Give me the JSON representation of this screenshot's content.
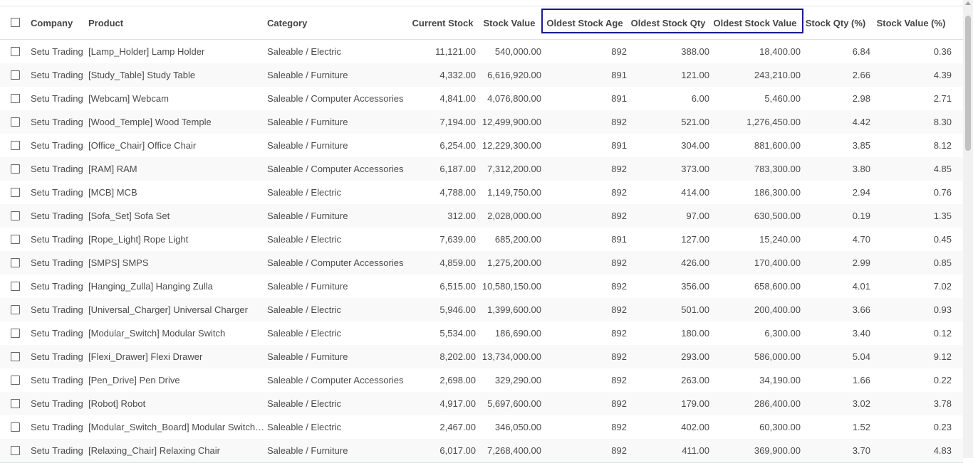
{
  "table": {
    "columns": {
      "company": "Company",
      "product": "Product",
      "category": "Category",
      "current_stock": "Current Stock",
      "stock_value": "Stock Value",
      "oldest_stock_age": "Oldest Stock Age",
      "oldest_stock_qty": "Oldest Stock Qty",
      "oldest_stock_value": "Oldest Stock Value",
      "stock_qty_pct": "Stock Qty (%)",
      "stock_value_pct": "Stock Value (%)"
    },
    "rows": [
      {
        "company": "Setu Trading",
        "product": "[Lamp_Holder] Lamp Holder",
        "category": "Saleable / Electric",
        "current_stock": "11,121.00",
        "stock_value": "540,000.00",
        "oldest_stock_age": "892",
        "oldest_stock_qty": "388.00",
        "oldest_stock_value": "18,400.00",
        "stock_qty_pct": "6.84",
        "stock_value_pct": "0.36"
      },
      {
        "company": "Setu Trading",
        "product": "[Study_Table] Study Table",
        "category": "Saleable / Furniture",
        "current_stock": "4,332.00",
        "stock_value": "6,616,920.00",
        "oldest_stock_age": "891",
        "oldest_stock_qty": "121.00",
        "oldest_stock_value": "243,210.00",
        "stock_qty_pct": "2.66",
        "stock_value_pct": "4.39"
      },
      {
        "company": "Setu Trading",
        "product": "[Webcam] Webcam",
        "category": "Saleable / Computer Accessories",
        "current_stock": "4,841.00",
        "stock_value": "4,076,800.00",
        "oldest_stock_age": "891",
        "oldest_stock_qty": "6.00",
        "oldest_stock_value": "5,460.00",
        "stock_qty_pct": "2.98",
        "stock_value_pct": "2.71"
      },
      {
        "company": "Setu Trading",
        "product": "[Wood_Temple] Wood Temple",
        "category": "Saleable / Furniture",
        "current_stock": "7,194.00",
        "stock_value": "12,499,900.00",
        "oldest_stock_age": "892",
        "oldest_stock_qty": "521.00",
        "oldest_stock_value": "1,276,450.00",
        "stock_qty_pct": "4.42",
        "stock_value_pct": "8.30"
      },
      {
        "company": "Setu Trading",
        "product": "[Office_Chair] Office Chair",
        "category": "Saleable / Furniture",
        "current_stock": "6,254.00",
        "stock_value": "12,229,300.00",
        "oldest_stock_age": "891",
        "oldest_stock_qty": "304.00",
        "oldest_stock_value": "881,600.00",
        "stock_qty_pct": "3.85",
        "stock_value_pct": "8.12"
      },
      {
        "company": "Setu Trading",
        "product": "[RAM] RAM",
        "category": "Saleable / Computer Accessories",
        "current_stock": "6,187.00",
        "stock_value": "7,312,200.00",
        "oldest_stock_age": "892",
        "oldest_stock_qty": "373.00",
        "oldest_stock_value": "783,300.00",
        "stock_qty_pct": "3.80",
        "stock_value_pct": "4.85"
      },
      {
        "company": "Setu Trading",
        "product": "[MCB] MCB",
        "category": "Saleable / Electric",
        "current_stock": "4,788.00",
        "stock_value": "1,149,750.00",
        "oldest_stock_age": "892",
        "oldest_stock_qty": "414.00",
        "oldest_stock_value": "186,300.00",
        "stock_qty_pct": "2.94",
        "stock_value_pct": "0.76"
      },
      {
        "company": "Setu Trading",
        "product": "[Sofa_Set] Sofa Set",
        "category": "Saleable / Furniture",
        "current_stock": "312.00",
        "stock_value": "2,028,000.00",
        "oldest_stock_age": "892",
        "oldest_stock_qty": "97.00",
        "oldest_stock_value": "630,500.00",
        "stock_qty_pct": "0.19",
        "stock_value_pct": "1.35"
      },
      {
        "company": "Setu Trading",
        "product": "[Rope_Light] Rope Light",
        "category": "Saleable / Electric",
        "current_stock": "7,639.00",
        "stock_value": "685,200.00",
        "oldest_stock_age": "891",
        "oldest_stock_qty": "127.00",
        "oldest_stock_value": "15,240.00",
        "stock_qty_pct": "4.70",
        "stock_value_pct": "0.45"
      },
      {
        "company": "Setu Trading",
        "product": "[SMPS] SMPS",
        "category": "Saleable / Computer Accessories",
        "current_stock": "4,859.00",
        "stock_value": "1,275,200.00",
        "oldest_stock_age": "892",
        "oldest_stock_qty": "426.00",
        "oldest_stock_value": "170,400.00",
        "stock_qty_pct": "2.99",
        "stock_value_pct": "0.85"
      },
      {
        "company": "Setu Trading",
        "product": "[Hanging_Zulla] Hanging Zulla",
        "category": "Saleable / Furniture",
        "current_stock": "6,515.00",
        "stock_value": "10,580,150.00",
        "oldest_stock_age": "892",
        "oldest_stock_qty": "356.00",
        "oldest_stock_value": "658,600.00",
        "stock_qty_pct": "4.01",
        "stock_value_pct": "7.02"
      },
      {
        "company": "Setu Trading",
        "product": "[Universal_Charger] Universal Charger",
        "category": "Saleable / Electric",
        "current_stock": "5,946.00",
        "stock_value": "1,399,600.00",
        "oldest_stock_age": "892",
        "oldest_stock_qty": "501.00",
        "oldest_stock_value": "200,400.00",
        "stock_qty_pct": "3.66",
        "stock_value_pct": "0.93"
      },
      {
        "company": "Setu Trading",
        "product": "[Modular_Switch] Modular Switch",
        "category": "Saleable / Electric",
        "current_stock": "5,534.00",
        "stock_value": "186,690.00",
        "oldest_stock_age": "892",
        "oldest_stock_qty": "180.00",
        "oldest_stock_value": "6,300.00",
        "stock_qty_pct": "3.40",
        "stock_value_pct": "0.12"
      },
      {
        "company": "Setu Trading",
        "product": "[Flexi_Drawer] Flexi Drawer",
        "category": "Saleable / Furniture",
        "current_stock": "8,202.00",
        "stock_value": "13,734,000.00",
        "oldest_stock_age": "892",
        "oldest_stock_qty": "293.00",
        "oldest_stock_value": "586,000.00",
        "stock_qty_pct": "5.04",
        "stock_value_pct": "9.12"
      },
      {
        "company": "Setu Trading",
        "product": "[Pen_Drive] Pen Drive",
        "category": "Saleable / Computer Accessories",
        "current_stock": "2,698.00",
        "stock_value": "329,290.00",
        "oldest_stock_age": "892",
        "oldest_stock_qty": "263.00",
        "oldest_stock_value": "34,190.00",
        "stock_qty_pct": "1.66",
        "stock_value_pct": "0.22"
      },
      {
        "company": "Setu Trading",
        "product": "[Robot] Robot",
        "category": "Saleable / Electric",
        "current_stock": "4,917.00",
        "stock_value": "5,697,600.00",
        "oldest_stock_age": "892",
        "oldest_stock_qty": "179.00",
        "oldest_stock_value": "286,400.00",
        "stock_qty_pct": "3.02",
        "stock_value_pct": "3.78"
      },
      {
        "company": "Setu Trading",
        "product": "[Modular_Switch_Board] Modular Switch…",
        "category": "Saleable / Electric",
        "current_stock": "2,467.00",
        "stock_value": "346,050.00",
        "oldest_stock_age": "892",
        "oldest_stock_qty": "402.00",
        "oldest_stock_value": "60,300.00",
        "stock_qty_pct": "1.52",
        "stock_value_pct": "0.23"
      },
      {
        "company": "Setu Trading",
        "product": "[Relaxing_Chair] Relaxing Chair",
        "category": "Saleable / Furniture",
        "current_stock": "6,017.00",
        "stock_value": "7,268,400.00",
        "oldest_stock_age": "892",
        "oldest_stock_qty": "411.00",
        "oldest_stock_value": "369,900.00",
        "stock_qty_pct": "3.70",
        "stock_value_pct": "4.83"
      }
    ]
  }
}
